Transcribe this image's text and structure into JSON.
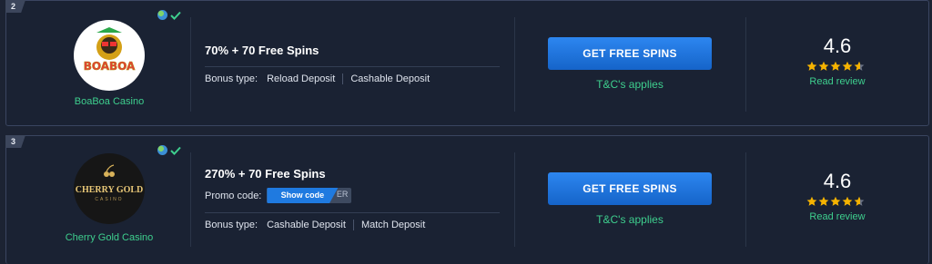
{
  "listings": [
    {
      "rank": "2",
      "casino_name": "BoaBoa Casino",
      "logo_text": "BOABOA",
      "bonus_title": "70% + 70 Free Spins",
      "bonus_type_label": "Bonus type:",
      "bonus_types": [
        "Reload Deposit",
        "Cashable Deposit"
      ],
      "cta_label": "GET FREE SPINS",
      "tc_label": "T&C's applies",
      "rating": "4.6",
      "stars": 4.6,
      "read_review": "Read review"
    },
    {
      "rank": "3",
      "casino_name": "Cherry Gold Casino",
      "logo_text": "CHERRY GOLD",
      "logo_subtext": "CASINO",
      "bonus_title": "270% + 70 Free Spins",
      "promo_label": "Promo code:",
      "promo_button": "Show code",
      "promo_code_hint": "ER",
      "bonus_type_label": "Bonus type:",
      "bonus_types": [
        "Cashable Deposit",
        "Match Deposit"
      ],
      "cta_label": "GET FREE SPINS",
      "tc_label": "T&C's applies",
      "rating": "4.6",
      "stars": 4.6,
      "read_review": "Read review"
    }
  ],
  "colors": {
    "accent_green": "#3ecf8e",
    "cta_blue": "#1f7ae0",
    "star_gold": "#f5b301",
    "background": "#1c2333"
  }
}
